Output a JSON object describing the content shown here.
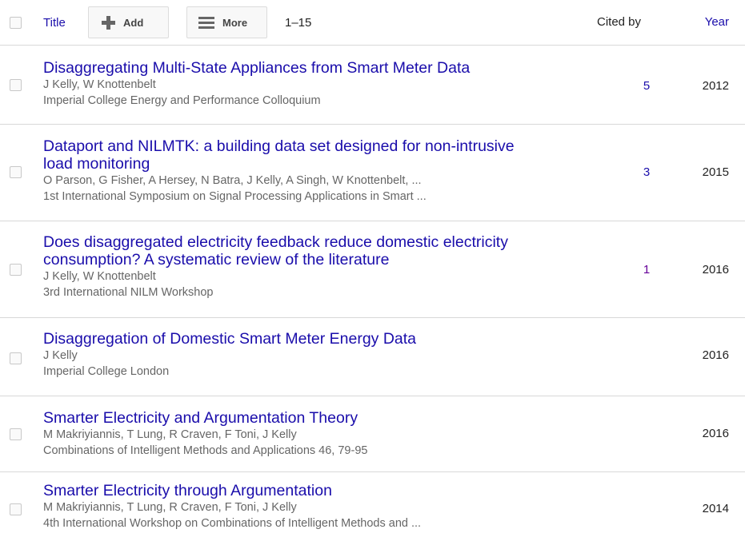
{
  "header": {
    "title_label": "Title",
    "add_label": "Add",
    "more_label": "More",
    "range": "1–15",
    "cited_by_label": "Cited by",
    "year_label": "Year"
  },
  "articles": [
    {
      "title": "Disaggregating Multi-State Appliances from Smart Meter Data",
      "authors": "J Kelly, W Knottenbelt",
      "venue": "Imperial College Energy and Performance Colloquium",
      "cited_by": "5",
      "year": "2012"
    },
    {
      "title": "Dataport and NILMTK: a building data set designed for non-intrusive load monitoring",
      "authors": "O Parson, G Fisher, A Hersey, N Batra, J Kelly, A Singh, W Knottenbelt, ...",
      "venue": "1st International Symposium on Signal Processing Applications in Smart ...",
      "cited_by": "3",
      "year": "2015"
    },
    {
      "title": "Does disaggregated electricity feedback reduce domestic electricity consumption? A systematic review of the literature",
      "authors": "J Kelly, W Knottenbelt",
      "venue": "3rd International NILM Workshop",
      "cited_by": "1",
      "year": "2016"
    },
    {
      "title": "Disaggregation of Domestic Smart Meter Energy Data",
      "authors": "J Kelly",
      "venue": "Imperial College London",
      "cited_by": "",
      "year": "2016"
    },
    {
      "title": "Smarter Electricity and Argumentation Theory",
      "authors": "M Makriyiannis, T Lung, R Craven, F Toni, J Kelly",
      "venue": "Combinations of Intelligent Methods and Applications 46, 79-95",
      "cited_by": "",
      "year": "2016"
    },
    {
      "title": "Smarter Electricity through Argumentation",
      "authors": "M Makriyiannis, T Lung, R Craven, F Toni, J Kelly",
      "venue": "4th International Workshop on Combinations of Intelligent Methods and ...",
      "cited_by": "",
      "year": "2014"
    }
  ],
  "colors": {
    "link": "#1a0dab",
    "visited_link": "#660099",
    "meta_text": "#666666",
    "divider": "#d8d8d8"
  }
}
